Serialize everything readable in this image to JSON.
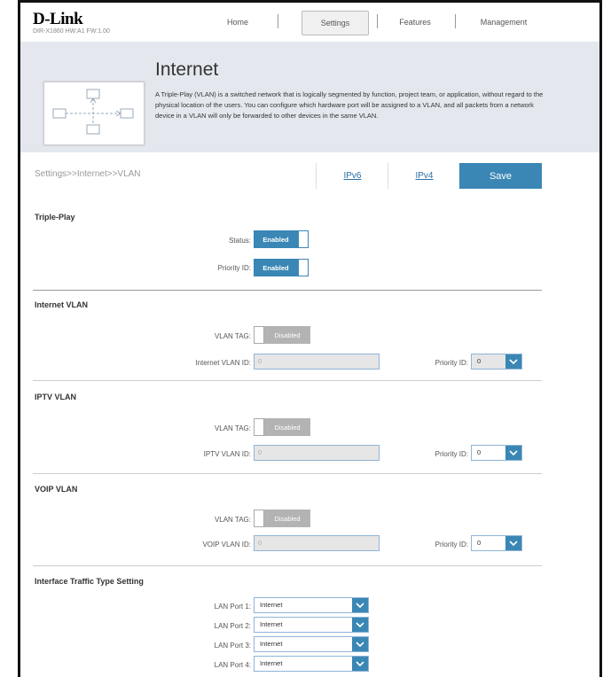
{
  "brand": {
    "logo": "D-Link",
    "model_info": "DIR-X1860 HW:A1 FW:1.00"
  },
  "nav": {
    "home": "Home",
    "settings": "Settings",
    "features": "Features",
    "management": "Management"
  },
  "banner": {
    "title": "Internet",
    "description": "A Triple-Play (VLAN) is a switched network that is logically segmented by function, project team, or application, without regard to the physical location of the users. You can configure which hardware port will be assigned to a VLAN, and all packets from a network device in a VLAN will only be forwarded to other devices in the same VLAN."
  },
  "breadcrumb": "Settings>>Internet>>VLAN",
  "tabs": {
    "ipv6": "IPv6",
    "ipv4": "IPv4",
    "save": "Save"
  },
  "triple_play": {
    "title": "Triple-Play",
    "status_label": "Status:",
    "status_value": "Enabled",
    "priority_label": "Priority ID:",
    "priority_value": "Enabled"
  },
  "internet_vlan": {
    "title": "Internet VLAN",
    "tag_label": "VLAN TAG:",
    "tag_value": "Disabled",
    "id_label": "Internet VLAN ID:",
    "id_value": "0",
    "priority_label": "Priority ID:",
    "priority_value": "0"
  },
  "iptv_vlan": {
    "title": "IPTV VLAN",
    "tag_label": "VLAN TAG:",
    "tag_value": "Disabled",
    "id_label": "IPTV VLAN ID:",
    "id_value": "0",
    "priority_label": "Priority ID:",
    "priority_value": "0"
  },
  "voip_vlan": {
    "title": "VOIP VLAN",
    "tag_label": "VLAN TAG:",
    "tag_value": "Disabled",
    "id_label": "VOIP VLAN ID:",
    "id_value": "0",
    "priority_label": "Priority ID:",
    "priority_value": "0"
  },
  "traffic": {
    "title": "Interface Traffic Type Setting",
    "ports": [
      {
        "label": "LAN Port 1:",
        "value": "Internet"
      },
      {
        "label": "LAN Port 2:",
        "value": "Internet"
      },
      {
        "label": "LAN Port 3:",
        "value": "Internet"
      },
      {
        "label": "LAN Port 4:",
        "value": "Internet"
      }
    ]
  },
  "colors": {
    "accent": "#3a87b6",
    "disabled": "#b3b3b3",
    "banner_bg": "#e4e8ee"
  },
  "icons": {
    "select_arrow": "chevron-down-icon",
    "banner": "network-diagram-icon"
  }
}
